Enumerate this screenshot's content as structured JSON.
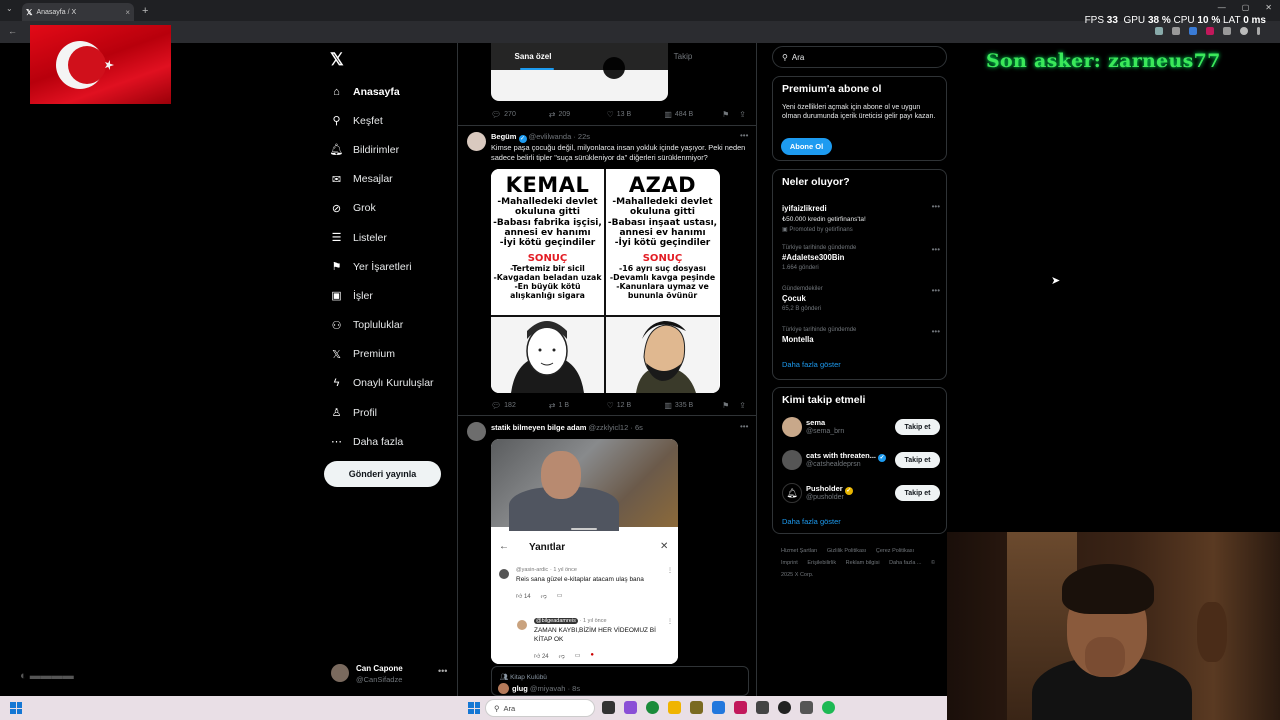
{
  "browser": {
    "tab_title": "Anasayfa / X",
    "new_tab": "+",
    "tab_close": "×"
  },
  "osd": {
    "fps_label": "FPS",
    "fps": "33",
    "gpu_label": "GPU",
    "gpu": "38 %",
    "cpu_label": "CPU",
    "cpu": "10 %",
    "lat_label": "LAT",
    "lat": "0 ms"
  },
  "overlay_text": "Son asker: zarneus77",
  "nav": {
    "items": [
      {
        "label": "Anasayfa",
        "icon": "home-icon"
      },
      {
        "label": "Keşfet",
        "icon": "search-icon"
      },
      {
        "label": "Bildirimler",
        "icon": "bell-icon"
      },
      {
        "label": "Mesajlar",
        "icon": "mail-icon"
      },
      {
        "label": "Grok",
        "icon": "grok-icon"
      },
      {
        "label": "Listeler",
        "icon": "list-icon"
      },
      {
        "label": "Yer İşaretleri",
        "icon": "bookmark-icon"
      },
      {
        "label": "İşler",
        "icon": "briefcase-icon"
      },
      {
        "label": "Topluluklar",
        "icon": "people-icon"
      },
      {
        "label": "Premium",
        "icon": "x-logo-icon"
      },
      {
        "label": "Onaylı Kuruluşlar",
        "icon": "lightning-icon"
      },
      {
        "label": "Profil",
        "icon": "person-icon"
      },
      {
        "label": "Daha fazla",
        "icon": "more-circle-icon"
      }
    ],
    "post_button": "Gönderi yayınla"
  },
  "account": {
    "name": "Can Capone",
    "handle": "@CanSifadze"
  },
  "timeline": {
    "tabs": [
      "Sana özel",
      "Takip"
    ],
    "top_actions": {
      "replies": "270",
      "reposts": "209",
      "likes": "13 B",
      "views": "484 B"
    },
    "tweet1": {
      "name": "Begüm",
      "handle": "@evlilwanda",
      "time": "· 22s",
      "text": "Kimse paşa çocuğu değil, milyonlarca insan yokluk içinde yaşıyor. Peki neden sadece belirli tipler \"suça sürükleniyor da\" diğerleri sürüklenmiyor?",
      "meme": {
        "left_title": "KEMAL",
        "left_lines": [
          "-Mahalledeki devlet",
          "okuluna gitti",
          "-Babası fabrika işçisi,",
          "annesi ev hanımı",
          "-İyi kötü geçindiler"
        ],
        "left_sonuc": "SONUÇ",
        "left_result": [
          "-Tertemiz bir sicil",
          "-Kavgadan beladan uzak",
          "-En büyük kötü",
          "alışkanlığı sigara"
        ],
        "right_title": "AZAD",
        "right_lines": [
          "-Mahalledeki devlet",
          "okuluna gitti",
          "-Babası inşaat ustası,",
          "annesi ev hanımı",
          "-İyi kötü geçindiler"
        ],
        "right_sonuc": "SONUÇ",
        "right_result": [
          "-16 ayrı suç dosyası",
          "-Devamlı kavga peşinde",
          "-Kanunlara uymaz ve",
          "bununla övünür"
        ]
      },
      "actions": {
        "replies": "182",
        "reposts": "1 B",
        "likes": "12 B",
        "views": "335 B"
      }
    },
    "tweet2": {
      "name": "statik bilmeyen bilge adam",
      "handle": "@zzklyicl12",
      "time": "· 6s",
      "sheet_title": "Yanıtlar",
      "c1_user": "@yasin-ardic",
      "c1_time": "· 1 yıl önce",
      "c1_text": "Reis sana güzel e-kitaplar atacam ulaş bana",
      "c1_likes": "14",
      "c2_user": "@bilgeadamreis",
      "c2_time": "· 1 yıl önce",
      "c2_text_1": "ZAMAN KAYBI,BİZİM HER VİDEOMUZ Bİ",
      "c2_text_2": "KİTAP OK",
      "c2_likes": "24"
    },
    "tweet3": {
      "community": "Kitap Kulübü",
      "name": "glug",
      "handle": "@miyavah",
      "time": "· 8s"
    }
  },
  "right": {
    "search_placeholder": "Ara",
    "premium": {
      "title": "Premium'a abone ol",
      "text": "Yeni özellikleri açmak için abone ol ve uygun olman durumunda içerik üreticisi gelir payı kazan.",
      "button": "Abone Ol"
    },
    "trends": {
      "title": "Neler oluyor?",
      "items": [
        {
          "category": "",
          "title": "iyifaizlikredi",
          "promo": "₺50.000 kredin getirfinans'ta!",
          "count": "Promoted by getirfinans"
        },
        {
          "category": "Türkiye tarihinde gündemde",
          "title": "#Adaletse300Bin",
          "promo": "",
          "count": "1.664 gönderi"
        },
        {
          "category": "Gündemdekiler",
          "title": "Çocuk",
          "promo": "",
          "count": "65,2 B gönderi"
        },
        {
          "category": "Türkiye tarihinde gündemde",
          "title": "Montella",
          "promo": "",
          "count": ""
        }
      ],
      "more": "Daha fazla göster"
    },
    "who": {
      "title": "Kimi takip etmeli",
      "people": [
        {
          "name": "sema",
          "handle": "@sema_brn",
          "button": "Takip et"
        },
        {
          "name": "cats with threaten...",
          "handle": "@catshealdeprsn",
          "button": "Takip et"
        },
        {
          "name": "Pusholder",
          "handle": "@pusholder",
          "button": "Takip et"
        }
      ],
      "more": "Daha fazla göster"
    },
    "footer": [
      "Hizmet Şartları",
      "Gizlilik Politikası",
      "Çerez Politikası",
      "Imprint",
      "Erişilebilirlik",
      "Reklam bilgisi",
      "Daha fazla ...",
      "© 2025 X Corp."
    ]
  },
  "taskbar": {
    "search": "Ara"
  },
  "colors": {
    "accent": "#1d9bf0",
    "overlay_green": "#3be85a",
    "flag_red": "#e30a17"
  }
}
